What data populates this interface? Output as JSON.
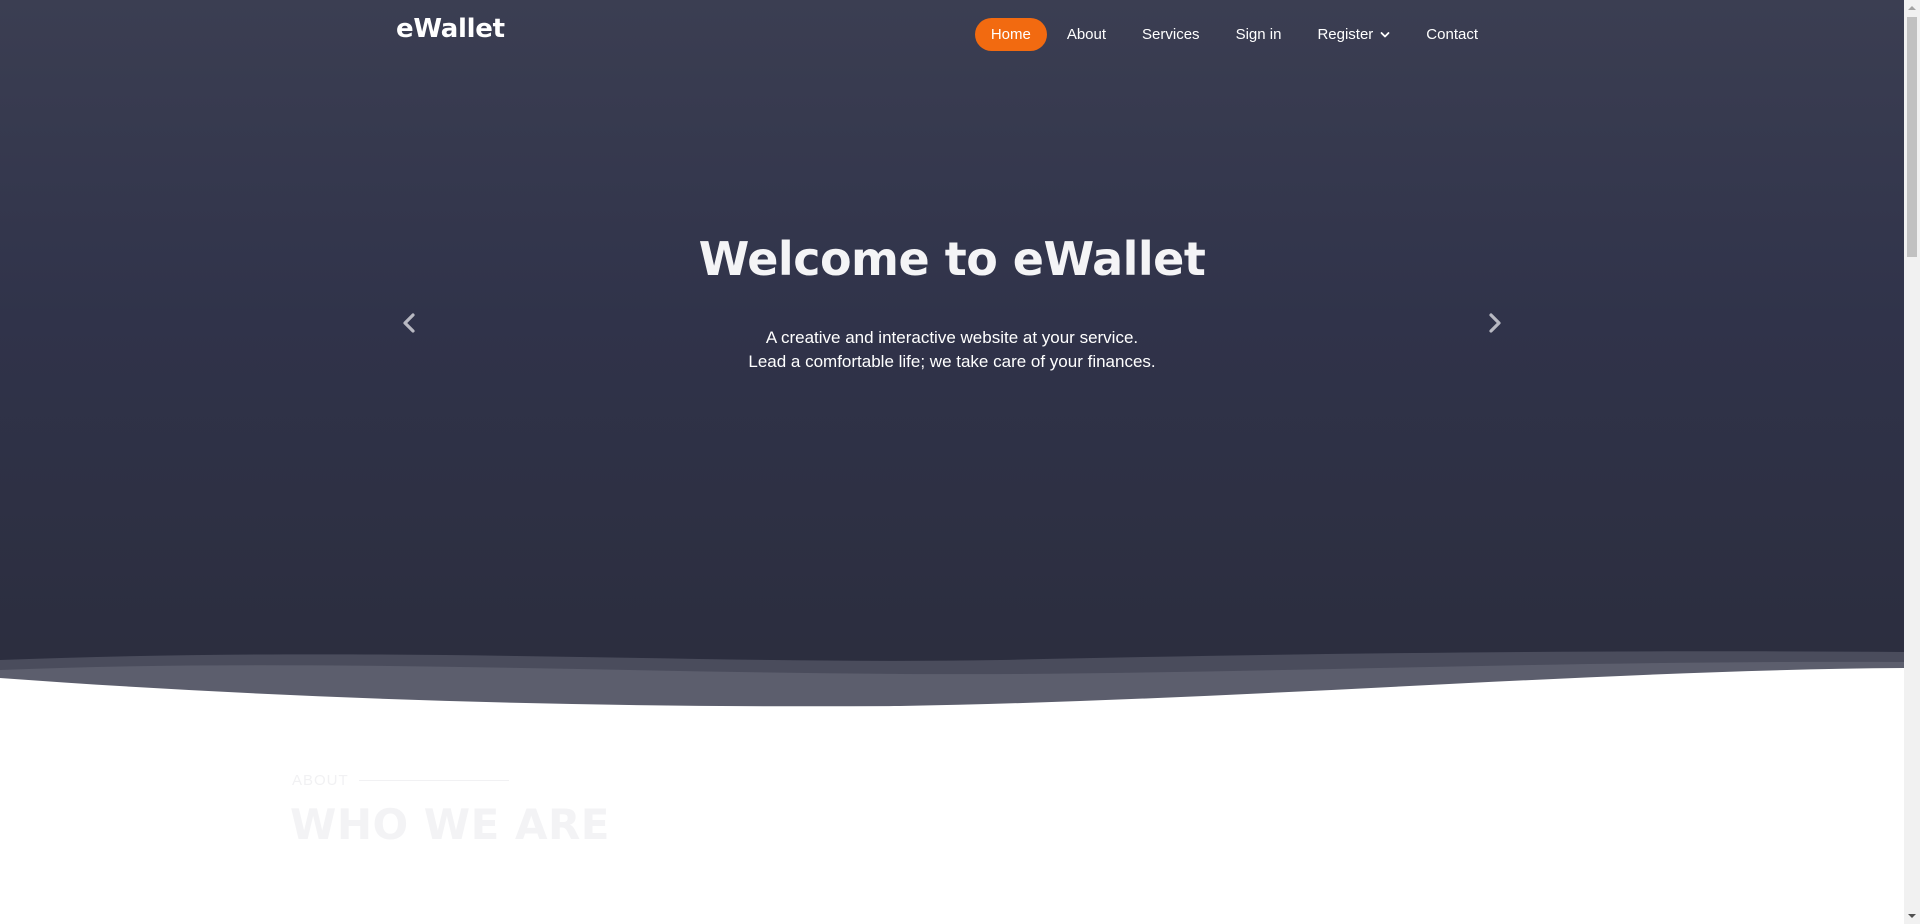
{
  "header": {
    "logo": "eWallet",
    "nav": [
      {
        "label": "Home",
        "active": true
      },
      {
        "label": "About"
      },
      {
        "label": "Services"
      },
      {
        "label": "Sign in"
      },
      {
        "label": "Register",
        "dropdown": true
      },
      {
        "label": "Contact"
      }
    ]
  },
  "hero": {
    "title": "Welcome to eWallet",
    "subtitle_line1": "A creative and interactive website at your service.",
    "subtitle_line2": "Lead a comfortable life; we take care of your finances.",
    "prev_icon": "chevron-left-icon",
    "next_icon": "chevron-right-icon"
  },
  "about": {
    "eyebrow": "ABOUT",
    "title": "WHO WE ARE"
  },
  "colors": {
    "accent": "#f26a10",
    "hero_top": "#3b3e52",
    "hero_bottom": "#2b2d3d"
  }
}
